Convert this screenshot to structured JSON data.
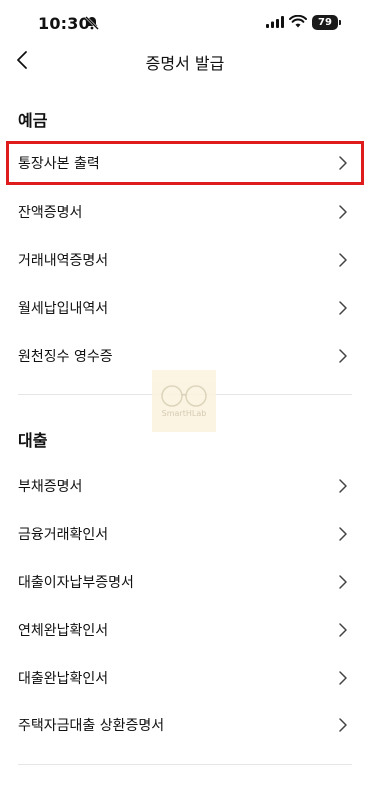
{
  "status_bar": {
    "time": "10:30",
    "battery": "79"
  },
  "header": {
    "title": "증명서 발급"
  },
  "sections": [
    {
      "title": "예금",
      "items": [
        {
          "label": "통장사본 출력"
        },
        {
          "label": "잔액증명서"
        },
        {
          "label": "거래내역증명서"
        },
        {
          "label": "월세납입내역서"
        },
        {
          "label": "원천징수 영수증"
        }
      ]
    },
    {
      "title": "대출",
      "items": [
        {
          "label": "부채증명서"
        },
        {
          "label": "금융거래확인서"
        },
        {
          "label": "대출이자납부증명서"
        },
        {
          "label": "연체완납확인서"
        },
        {
          "label": "대출완납확인서"
        },
        {
          "label": "주택자금대출 상환증명서"
        }
      ]
    },
    {
      "title": ""
    }
  ],
  "watermark": {
    "text": "SmartHLab"
  },
  "colors": {
    "highlight": "#e01b1b",
    "divider": "#e6e6e6"
  },
  "icons": [
    "bell-slash-icon",
    "signal-icon",
    "wifi-icon",
    "back-chevron-icon",
    "chevron-right-icon"
  ]
}
